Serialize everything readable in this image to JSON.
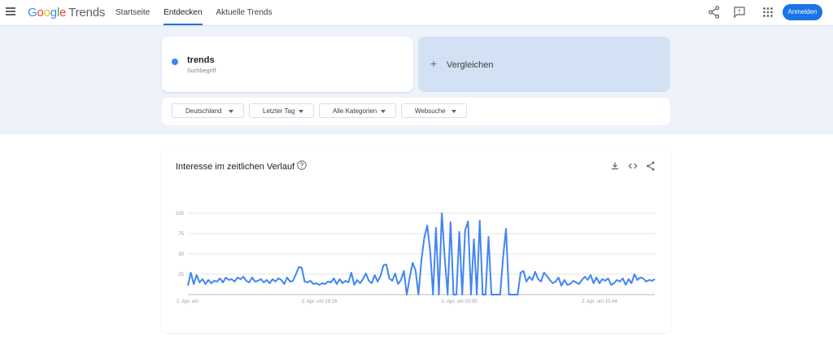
{
  "header": {
    "logo_google": [
      "G",
      "o",
      "o",
      "g",
      "l",
      "e"
    ],
    "logo_product": "Trends",
    "nav": [
      {
        "label": "Startseite",
        "active": false
      },
      {
        "label": "Entdecken",
        "active": true
      },
      {
        "label": "Aktuelle Trends",
        "active": false
      }
    ],
    "icons": [
      "share-icon",
      "feedback-icon",
      "apps-icon"
    ],
    "signin_label": "Anmelden",
    "accent": "#1a73e8"
  },
  "search": {
    "term": "trends",
    "term_type": "Suchbegriff",
    "term_color": "#4285f4",
    "compare_label": "Vergleichen"
  },
  "filters": [
    {
      "label": "Deutschland"
    },
    {
      "label": "Letzter Tag"
    },
    {
      "label": "Alle Kategorien"
    },
    {
      "label": "Websuche"
    }
  ],
  "chart_card": {
    "title": "Interesse im zeitlichen Verlauf",
    "icons": [
      "help-icon",
      "download-icon",
      "embed-icon",
      "share-icon"
    ]
  },
  "chart_data": {
    "type": "line",
    "title": "Interesse im zeitlichen Verlauf",
    "xlabel": "",
    "ylabel": "",
    "ylim": [
      0,
      100
    ],
    "yticks": [
      25,
      50,
      75,
      100
    ],
    "grid": true,
    "xtick_labels": [
      "1. Apr. um",
      "1. Apr. um 19:16",
      "2. Apr. um 03:00",
      "2. Apr. um 10:44"
    ],
    "xtick_index": [
      0,
      45,
      93,
      141
    ],
    "line_color": "#4285f4",
    "series": [
      {
        "values": [
          11,
          27,
          13,
          24,
          15,
          19,
          13,
          18,
          14,
          17,
          16,
          20,
          15,
          21,
          18,
          19,
          16,
          21,
          19,
          22,
          17,
          15,
          21,
          16,
          17,
          19,
          15,
          18,
          14,
          19,
          16,
          20,
          18,
          13,
          21,
          16,
          17,
          25,
          34,
          33,
          16,
          15,
          17,
          13,
          14,
          12,
          14,
          13,
          16,
          15,
          20,
          13,
          19,
          14,
          17,
          15,
          27,
          12,
          18,
          14,
          19,
          26,
          17,
          14,
          24,
          16,
          23,
          36,
          37,
          20,
          17,
          26,
          13,
          18,
          29,
          0,
          21,
          39,
          30,
          0,
          42,
          70,
          85,
          54,
          0,
          82,
          0,
          100,
          45,
          0,
          89,
          0,
          0,
          77,
          0,
          79,
          90,
          0,
          68,
          0,
          91,
          0,
          0,
          71,
          0,
          0,
          0,
          0,
          46,
          81,
          0,
          0,
          0,
          0,
          27,
          29,
          16,
          22,
          18,
          28,
          19,
          16,
          27,
          23,
          18,
          14,
          16,
          21,
          11,
          18,
          12,
          13,
          17,
          15,
          13,
          18,
          22,
          18,
          24,
          14,
          21,
          14,
          19,
          17,
          20,
          12,
          14,
          18,
          16,
          20,
          12,
          19,
          14,
          25,
          18,
          21,
          20,
          16,
          18,
          17,
          19
        ]
      }
    ]
  }
}
